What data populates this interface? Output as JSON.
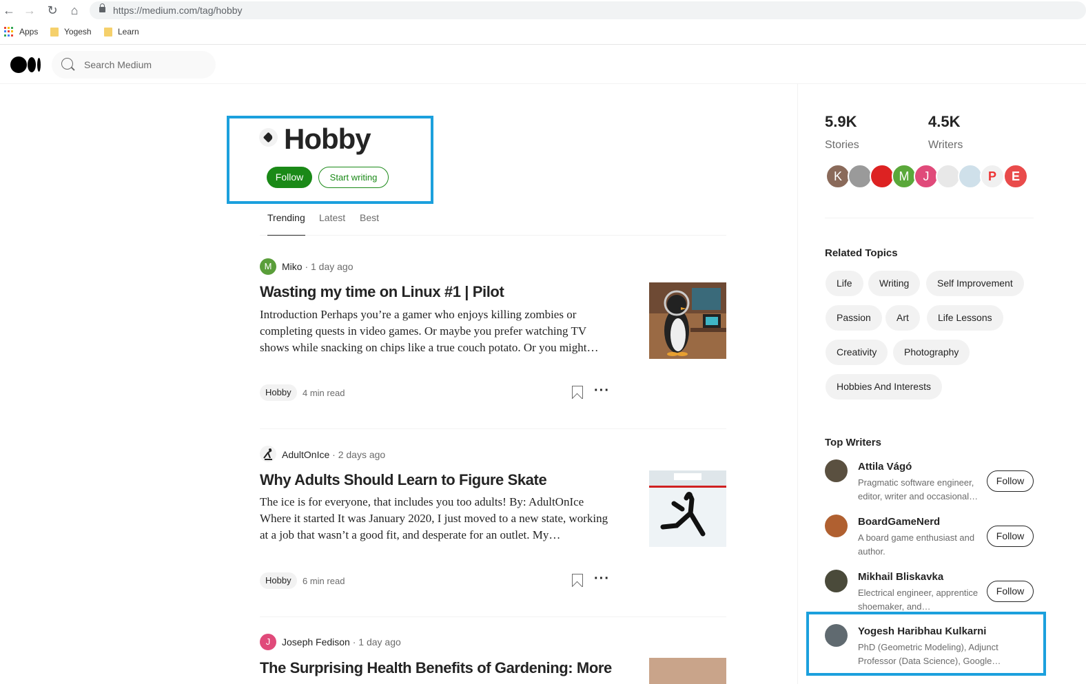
{
  "browser": {
    "url": "https://medium.com/tag/hobby",
    "bookmarks": [
      "Apps",
      "Yogesh",
      "Learn"
    ]
  },
  "header": {
    "search_placeholder": "Search Medium"
  },
  "tag": {
    "title": "Hobby",
    "follow_label": "Follow",
    "start_writing_label": "Start writing"
  },
  "tabs": [
    "Trending",
    "Latest",
    "Best"
  ],
  "posts": [
    {
      "author": "Miko",
      "ago": "· 1 day ago",
      "avatar_letter": "M",
      "avatar_color": "#5a9e3a",
      "title": "Wasting my time on Linux #1 | Pilot",
      "excerpt": "Introduction Perhaps you’re a gamer who enjoys killing zombies or completing quests in video games. Or maybe you prefer watching TV shows while snacking on chips like a true couch potato. Or you might…",
      "tag": "Hobby",
      "read_time": "4 min read"
    },
    {
      "author": "AdultOnIce",
      "ago": "· 2 days ago",
      "avatar_letter": "",
      "avatar_color": "#f2f2f2",
      "title": "Why Adults Should Learn to Figure Skate",
      "excerpt": "The ice is for everyone, that includes you too adults! By: AdultOnIce Where it started It was January 2020, I just moved to a new state, working at a job that wasn’t a good fit, and desperate for an outlet. My…",
      "tag": "Hobby",
      "read_time": "6 min read"
    },
    {
      "author": "Joseph Fedison",
      "ago": "· 1 day ago",
      "avatar_letter": "J",
      "avatar_color": "#e04a7a",
      "title": "The Surprising Health Benefits of Gardening: More",
      "excerpt": "",
      "tag": "",
      "read_time": ""
    }
  ],
  "stats": {
    "stories_value": "5.9K",
    "stories_label": "Stories",
    "writers_value": "4.5K",
    "writers_label": "Writers"
  },
  "avatars": [
    {
      "letter": "K",
      "color": "#8a6a5a"
    },
    {
      "letter": "",
      "color": "#9a9a9a"
    },
    {
      "letter": "",
      "color": "#d22"
    },
    {
      "letter": "M",
      "color": "#5aa83a"
    },
    {
      "letter": "J",
      "color": "#e04a7a"
    },
    {
      "letter": "",
      "color": "#e8e8e8"
    },
    {
      "letter": "",
      "color": "#cfe0ea"
    },
    {
      "letter": "P",
      "color": "#f0f0f0"
    },
    {
      "letter": "E",
      "color": "#e94b4b"
    }
  ],
  "related": {
    "heading": "Related Topics",
    "topics": [
      "Life",
      "Writing",
      "Self Improvement",
      "Passion",
      "Art",
      "Life Lessons",
      "Creativity",
      "Photography",
      "Hobbies And Interests"
    ]
  },
  "top_writers": {
    "heading": "Top Writers",
    "writers": [
      {
        "name": "Attila Vágó",
        "desc": "Pragmatic software engineer, editor, writer and occasional…",
        "follow": "Follow",
        "color": "#5a5040"
      },
      {
        "name": "BoardGameNerd",
        "desc": "A board game enthusiast and author.",
        "follow": "Follow",
        "color": "#b06030"
      },
      {
        "name": "Mikhail Bliskavka",
        "desc": "Electrical engineer, apprentice shoemaker, and…",
        "follow": "Follow",
        "color": "#4a4a3a"
      },
      {
        "name": "Yogesh Haribhau Kulkarni",
        "desc": "PhD (Geometric Modeling), Adjunct Professor (Data Science), Google…",
        "follow": "",
        "color": "#606a70"
      }
    ]
  },
  "colors": {
    "accent": "#1a8917",
    "highlight": "#1ba0dd"
  }
}
